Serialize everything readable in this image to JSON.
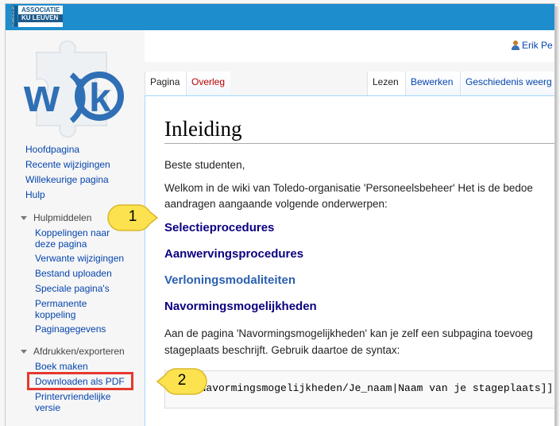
{
  "header": {
    "org_vertical_text": "POWERED BY",
    "org_line1": "ASSOCIATIE",
    "org_line2": "KU LEUVEN",
    "brand_color": "#1d8dcd"
  },
  "user": {
    "name": "Erik Pe",
    "icon": "user-icon"
  },
  "logo": {
    "text": "wiki",
    "icon": "puzzle-logo"
  },
  "navigation": {
    "links": [
      "Hoofdpagina",
      "Recente wijzigingen",
      "Willekeurige pagina",
      "Hulp"
    ]
  },
  "tools": {
    "heading": "Hulpmiddelen",
    "links": [
      "Koppelingen naar deze pagina",
      "Verwante wijzigingen",
      "Bestand uploaden",
      "Speciale pagina's",
      "Permanente koppeling",
      "Paginagegevens"
    ]
  },
  "print": {
    "heading": "Afdrukken/exporteren",
    "links": [
      "Boek maken",
      "Downloaden als PDF",
      "Printervriendelijke versie"
    ]
  },
  "tabs": {
    "left": [
      "Pagina",
      "Overleg"
    ],
    "right": [
      "Lezen",
      "Bewerken",
      "Geschiedenis weerg"
    ]
  },
  "page": {
    "title": "Inleiding",
    "greeting": "Beste studenten,",
    "intro_line1": "Welkom in de wiki van Toledo-organisatie 'Personeelsbeheer' Het is de bedoe",
    "intro_line2": "aandragen aangaande volgende onderwerpen:",
    "topics": [
      "Selectieprocedures",
      "Aanwervingsprocedures",
      "Verloningsmodaliteiten",
      "Navormingsmogelijkheden"
    ],
    "para_line1": "Aan de pagina 'Navormingsmogelijkheden' kan je zelf een subpagina toevoeg",
    "para_line2": "stageplaats beschrijft. Gebruik daartoe de syntax:",
    "code": "[[Navormingsmogelijkheden/Je_naam|Naam van je stageplaats]]"
  },
  "callouts": [
    "1",
    "2"
  ],
  "colors": {
    "link": "#0645ad",
    "visited_heading": "#0b0080",
    "callout_fill": "#fde24f",
    "highlight": "#e53a2f"
  }
}
